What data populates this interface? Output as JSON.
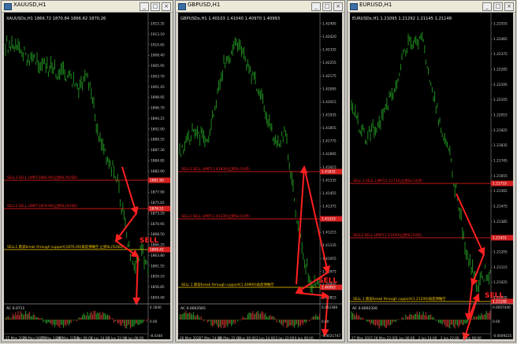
{
  "windows": [
    {
      "window_title": "XAUUSD,H1",
      "header": "XAUUSDx,H1  1866.72 1870.84 1866.62 1870.26",
      "prices": [
        "1915.35",
        "1913.10",
        "1910.65",
        "1908.40",
        "1905.95",
        "1903.70",
        "1901.45",
        "1898.95",
        "1896.70",
        "1894.25",
        "1892.00",
        "1889.55",
        "1887.30",
        "1884.85",
        "1882.60",
        "1880.15",
        "1877.90",
        "1875.65",
        "1873.20",
        "1870.95",
        "1868.50",
        "1866.25",
        "1863.80",
        "1861.55",
        "1859.10",
        "1856.85",
        "1854.40"
      ],
      "levels": [
        {
          "text": "SELL3 SELL LIMIT(1885.90)止损SL(5USD)",
          "price_tag": "1881.90",
          "color": "#ff2020"
        },
        {
          "text": "SELL2 SELL LIMIT(1878.90)止损SL(5USD)",
          "price_tag": "1876.51",
          "color": "#ff2020"
        },
        {
          "text": "SELL1 跌穿break through support(1876.00)再反弹做空 止损SL(5USD)",
          "price_tag": "1869.42",
          "color": "#ffd000"
        }
      ],
      "sell_label": "SELL",
      "osc_label": "AC 0.0711",
      "osc_ticks": [
        "4.1840",
        "0.00",
        "-8.4340"
      ],
      "time_labels": [
        "25 May 2021",
        "26 May 04:00",
        "27 May 14:00",
        "28 May 22:00",
        "1 Jun 06:00",
        "2 Jun 14:00",
        "3 Jun 22:00",
        "4 Jun 06:00"
      ]
    },
    {
      "window_title": "GBPUSD,H1",
      "header": "GBPUSDx,H1  1.40103 1.41040 1.40970 1.40993",
      "prices": [
        "1.42495",
        "1.42420",
        "1.42335",
        "1.42255",
        "1.42175",
        "1.42095",
        "1.42015",
        "1.41935",
        "1.41855",
        "1.41775",
        "1.41695",
        "1.41615",
        "1.41535",
        "1.41455",
        "1.41375",
        "1.41295",
        "1.41215",
        "1.41135",
        "1.41055",
        "1.40975",
        "1.40895",
        "1.40815"
      ],
      "levels": [
        {
          "text": "SELL3 SELL LIMIT(1.41830)止损SL(10点)",
          "price_tag": "1.41832",
          "color": "#ff2020"
        },
        {
          "text": "SELL2 SELL LIMIT(1.41330)止损SL(10点)",
          "price_tag": "1.41333",
          "color": "#ff2020"
        },
        {
          "text": "SELL 1 跌穿break through support(1.40900)再反弹做空",
          "price_tag": "1.40993",
          "color": "#ffd000"
        }
      ],
      "sell_label": "SELL",
      "osc_label": "AC 0.0003565",
      "osc_ticks": [
        "0.002388",
        "0.00",
        "-0.0021747"
      ],
      "time_labels": [
        "26 May 2021",
        "27 May 14:00",
        "28 May 22:00",
        "1 Jun 06:00",
        "2 Jun 14:00",
        "3 Jun 22:00",
        "4 Jun 06:00"
      ]
    },
    {
      "window_title": "EURUSD,H1",
      "header": "EURUSDx,H1  1.21095 1.21292 1.21145 1.21148",
      "prices": [
        "1.22555",
        "1.22465",
        "1.22375",
        "1.22285",
        "1.22195",
        "1.22105",
        "1.22015",
        "1.21925",
        "1.21835",
        "1.21745",
        "1.21655",
        "1.21565",
        "1.21475",
        "1.21385",
        "1.21295",
        "1.21205",
        "1.21115",
        "1.21025",
        "1.20935"
      ],
      "levels": [
        {
          "text": "SELL 3 SELL LIMIT(1.21730)止损SL(10点)",
          "price_tag": "1.21733",
          "color": "#ff2020"
        },
        {
          "text": "SELL2 SELL LIMIT(1.21430)止损SL(10点)",
          "price_tag": "1.21431",
          "color": "#ff2020"
        },
        {
          "text": "SELL 1 跌穿break through support(1.21200)再反弹做空",
          "price_tag": "1.21148",
          "color": "#ffd000"
        }
      ],
      "sell_label": "SELL",
      "osc_label": "AC 0.0002326",
      "osc_ticks": [
        "0.0007440",
        "0.00",
        "-0.0009225"
      ],
      "time_labels": [
        "27 May 2021",
        "28 May 22:00",
        "1 Jun 06:00",
        "2 Jun 14:00",
        "3 Jun 22:00",
        "4 Jun 06:00"
      ]
    }
  ],
  "colors": {
    "candle": "#1f8a1f",
    "grid": "#1a3a1a",
    "axis_text": "#cfcfcf",
    "red": "#ff2020",
    "yellow": "#ffd000",
    "osc_up": "#2b9a2b",
    "osc_down": "#c23030"
  }
}
